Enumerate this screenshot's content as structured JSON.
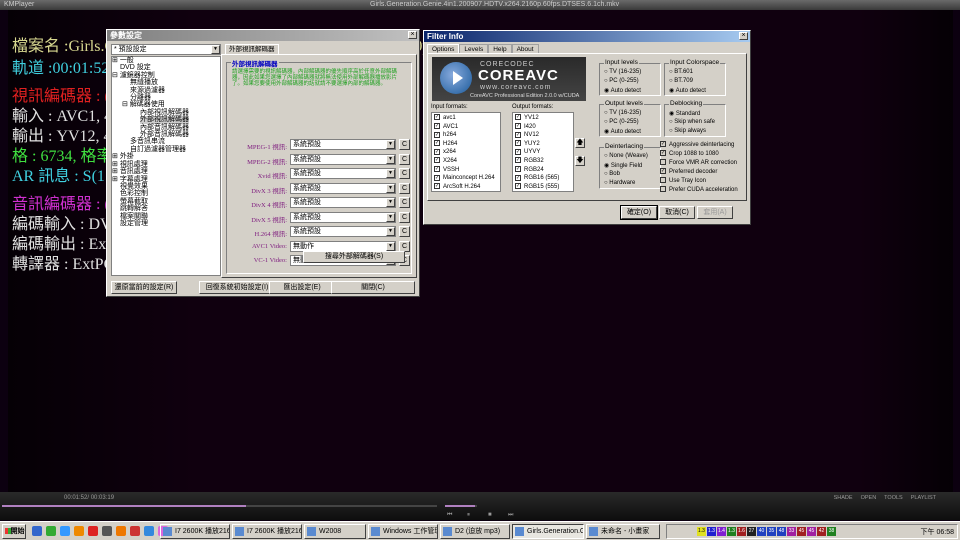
{
  "window": {
    "app_name": "KMPlayer",
    "title": "Girls.Generation.Genie.4in1.200907.HDTV.x264.2160p.60fps.DTSES.6.1ch.mkv"
  },
  "osd": [
    {
      "text": "檔案名 :Girls.Generation Genie 4in1 200907 HDTV x264 2160p 60fps DTSES 6.1ch mkv",
      "color": "#d8d890"
    },
    {
      "text": "軌道 :00:01:52/0",
      "color": "#40d0e0"
    },
    {
      "text": "視訊編碼器 : (M",
      "color": "#e02020"
    },
    {
      "text": "輸入 : AVC1, 40",
      "color": "#e0e0e0"
    },
    {
      "text": "輸出 : YV12, 40",
      "color": "#e0e0e0"
    },
    {
      "text": "格 : 6734, 格率",
      "color": "#40e040"
    },
    {
      "text": "AR 訊息 : S(1.9",
      "color": "#40d0e0"
    },
    {
      "text": "音訊編碼器 : ((",
      "color": "#d030d0"
    },
    {
      "text": "編碼輸入 : DVI",
      "color": "#e0e0e0"
    },
    {
      "text": "編碼輸出 : ExtP",
      "color": "#e0e0e0"
    },
    {
      "text": "轉譯器 : ExtPCI",
      "color": "#e0e0e0"
    }
  ],
  "settings": {
    "title": "參數設定",
    "preset": "* 預設設定",
    "tree": [
      {
        "label": "一般",
        "indent": 0,
        "exp": "+"
      },
      {
        "label": "DVD 設定",
        "indent": 0
      },
      {
        "label": "濾鏡器控制",
        "indent": 0,
        "exp": "-"
      },
      {
        "label": "無縫播放",
        "indent": 1
      },
      {
        "label": "來源過濾器",
        "indent": 1
      },
      {
        "label": "分離器",
        "indent": 1
      },
      {
        "label": "解碼器使用",
        "indent": 1,
        "exp": "-"
      },
      {
        "label": "內部視訊解碼器",
        "indent": 2
      },
      {
        "label": "外部視訊解碼器",
        "indent": 2,
        "selected": true
      },
      {
        "label": "內部音訊解碼器",
        "indent": 2
      },
      {
        "label": "外部音訊解碼器",
        "indent": 2
      },
      {
        "label": "多音訊串流",
        "indent": 1
      },
      {
        "label": "自訂過濾器管理器",
        "indent": 1
      },
      {
        "label": "外掛",
        "indent": 0,
        "exp": "+"
      },
      {
        "label": "視訊處理",
        "indent": 0,
        "exp": "+"
      },
      {
        "label": "音訊處理",
        "indent": 0,
        "exp": "+"
      },
      {
        "label": "字幕處理",
        "indent": 0,
        "exp": "+"
      },
      {
        "label": "視覺效果",
        "indent": 0
      },
      {
        "label": "色彩控制",
        "indent": 0
      },
      {
        "label": "螢幕截取",
        "indent": 0
      },
      {
        "label": "跳轉解答",
        "indent": 0
      },
      {
        "label": "檔案關聯",
        "indent": 0
      },
      {
        "label": "設定管理",
        "indent": 0
      }
    ],
    "tab": "外部視訊解碼器",
    "group_title": "外部視訊解碼器",
    "description": "請選擇需要的視訊解碼器，內部解碼器的優先順序高於任意外部解碼器，因此如果您選擇了內部解碼器就將無法使用外部解碼器播放影片了。如果您要使用外部解碼器的話就請不要選擇內部的解碼器。",
    "decoders": [
      {
        "label": "MPEG-1 視訊:",
        "value": "系統預設"
      },
      {
        "label": "MPEG-2 視訊:",
        "value": "系統預設"
      },
      {
        "label": "Xvid 視訊:",
        "value": "系統預設"
      },
      {
        "label": "DivX 3 視訊:",
        "value": "系統預設"
      },
      {
        "label": "DivX 4 視訊:",
        "value": "系統預設"
      },
      {
        "label": "DivX 5 視訊:",
        "value": "系統預設"
      },
      {
        "label": "H.264 視訊:",
        "value": "系統預設"
      },
      {
        "label": "AVC1 Video:",
        "value": "無動作"
      },
      {
        "label": "VC-1 Video:",
        "value": "無動作"
      }
    ],
    "config_label": "C",
    "search_button": "搜尋外部解碼器(S)",
    "buttons": [
      "還原當前的設定(R)",
      "回復系統初始設定(I)",
      "匯出設定(E)",
      "關閉(C)"
    ]
  },
  "filter": {
    "title": "Filter Info",
    "tabs": [
      "Options",
      "Levels",
      "Help",
      "About"
    ],
    "logo": {
      "brand_small": "CORECODEC",
      "brand": "COREAVC",
      "url": "www.coreavc.com",
      "edition": "CoreAVC Professional Edition 2.0.0 w/CUDA"
    },
    "input_formats_label": "Input formats:",
    "input_formats": [
      "avc1",
      "AVC1",
      "h264",
      "H264",
      "x264",
      "X264",
      "VSSH",
      "Mainconcept H.264",
      "ArcSoft H.264"
    ],
    "output_formats_label": "Output formats:",
    "output_formats": [
      "YV12",
      "I420",
      "NV12",
      "YUY2",
      "UYVY",
      "RGB32",
      "RGB24",
      "RGB16 (565)",
      "RGB15 (555)"
    ],
    "groups": [
      {
        "title": "Input levels",
        "options": [
          "TV (16-235)",
          "PC (0-255)",
          "Auto detect"
        ],
        "selected": 2
      },
      {
        "title": "Input Colorspace",
        "options": [
          "BT.601",
          "BT.709",
          "Auto detect"
        ],
        "selected": 2
      },
      {
        "title": "Output levels",
        "options": [
          "TV (16-235)",
          "PC (0-255)",
          "Auto detect"
        ],
        "selected": 2
      },
      {
        "title": "Deblocking",
        "options": [
          "Standard",
          "Skip when safe",
          "Skip always"
        ],
        "selected": 0
      },
      {
        "title": "Deinterlacing",
        "options": [
          "None (Weave)",
          "Single Field",
          "Bob",
          "Hardware"
        ],
        "selected": 1
      }
    ],
    "checks": [
      {
        "label": "Aggressive deinterlacing",
        "checked": true
      },
      {
        "label": "Crop 1088 to 1080",
        "checked": true
      },
      {
        "label": "Force VMR AR correction",
        "checked": false
      },
      {
        "label": "Preferred decoder",
        "checked": true
      },
      {
        "label": "Use Tray Icon",
        "checked": false
      },
      {
        "label": "Prefer CUDA acceleration",
        "checked": false
      }
    ],
    "buttons": [
      "確定(O)",
      "取消(C)",
      "套用(A)"
    ]
  },
  "player": {
    "time": "00:01:52/ 00:03:19",
    "progress": 0.56,
    "volume": 0.95,
    "menu": [
      "SHADE",
      "OPEN",
      "TOOLS",
      "PLAYLIST"
    ]
  },
  "taskbar": {
    "start": "開始",
    "tasks": [
      "I7 2600K 播放2160P...",
      "I7 2600K 播放2160P...",
      "W2008",
      "Windows 工作管理員",
      "D2 (迫放 mp3)",
      "Girls.Generation.Geni...",
      "未命名 - 小畫家"
    ],
    "active_task": 5,
    "tray_values": [
      "1.3",
      "1.3",
      "1.4",
      "1.3",
      "1.6",
      "27",
      "40",
      "35",
      "48",
      "33",
      "45",
      "45",
      "42",
      "38"
    ],
    "tray_colors": [
      "#e0e020",
      "#2020d0",
      "#8020d0",
      "#208020",
      "#a02020",
      "#202020",
      "#2040c0",
      "#2040c0",
      "#2040c0",
      "#a020a0",
      "#a02020",
      "#a020a0",
      "#a02020",
      "#208020"
    ],
    "clock": "下午 06:58"
  }
}
